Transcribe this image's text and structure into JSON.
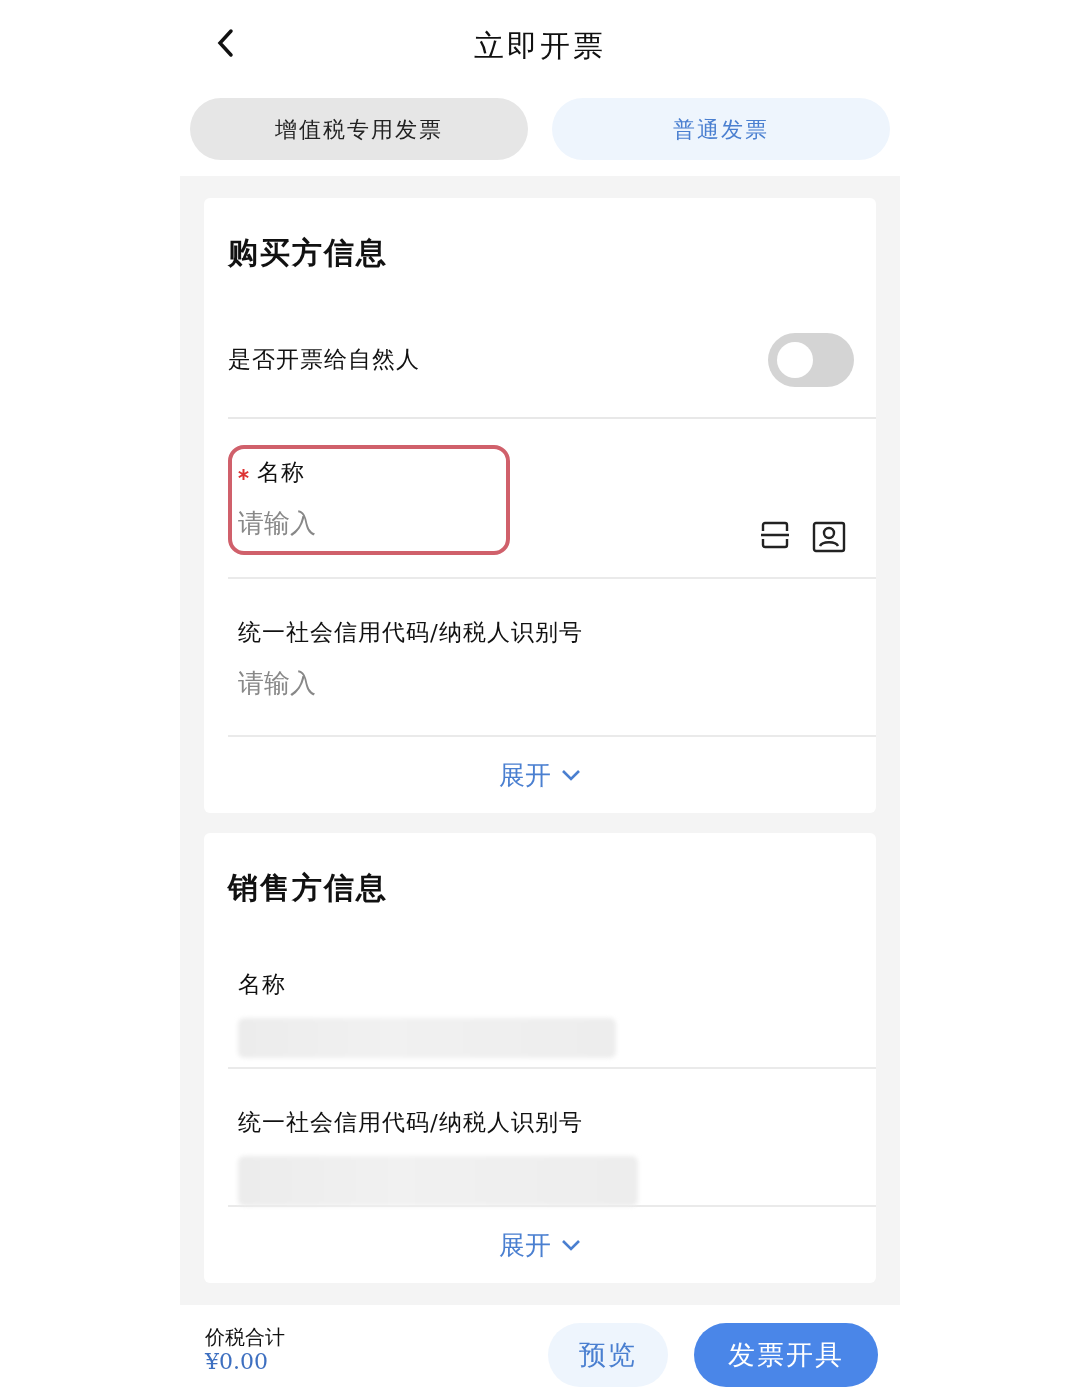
{
  "header": {
    "title": "立即开票"
  },
  "tabs": [
    {
      "label": "增值税专用发票",
      "selected": false
    },
    {
      "label": "普通发票",
      "selected": true
    }
  ],
  "sections": [
    {
      "title": "购买方信息",
      "toggle": {
        "label": "是否开票给自然人",
        "on": false
      },
      "fields": [
        {
          "label": "名称",
          "required": true,
          "highlighted": true,
          "placeholder": "请输入",
          "has_actions": true,
          "redacted": false
        },
        {
          "label": "统一社会信用代码/纳税人识别号",
          "required": false,
          "highlighted": false,
          "placeholder": "请输入",
          "has_actions": false,
          "redacted": false
        }
      ],
      "expand": "展开"
    },
    {
      "title": "销售方信息",
      "fields": [
        {
          "label": "名称",
          "required": false,
          "highlighted": false,
          "has_actions": false,
          "redacted": true
        },
        {
          "label": "统一社会信用代码/纳税人识别号",
          "required": false,
          "highlighted": false,
          "has_actions": false,
          "redacted": true
        }
      ],
      "expand": "展开"
    }
  ],
  "footer": {
    "total_label": "价税合计",
    "total": "¥0.00",
    "buttons": [
      {
        "label": "预览",
        "kind": "secondary"
      },
      {
        "label": "发票开具",
        "kind": "primary"
      }
    ]
  }
}
